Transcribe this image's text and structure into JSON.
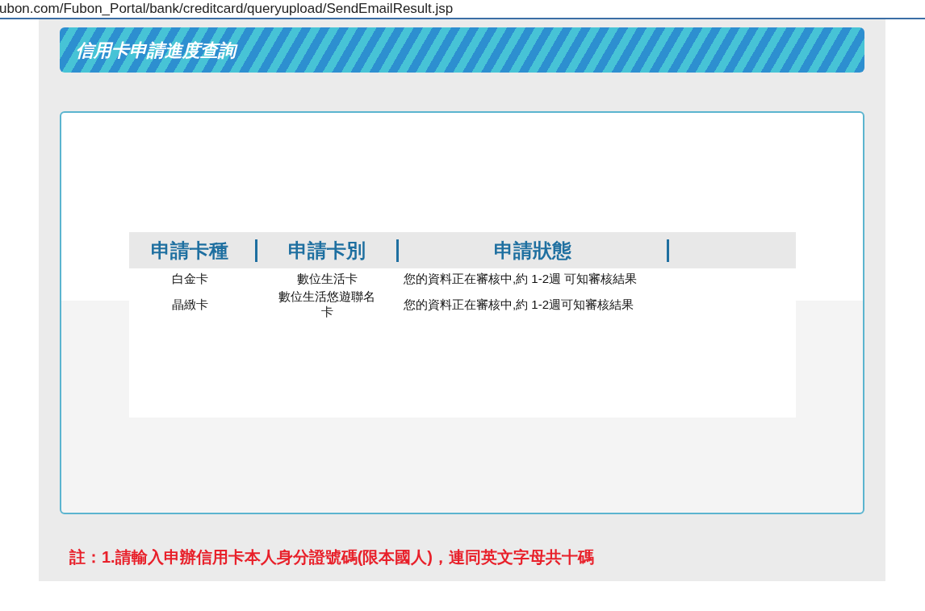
{
  "address_bar": {
    "url": "ubon.com/Fubon_Portal/bank/creditcard/queryupload/SendEmailResult.jsp"
  },
  "banner": {
    "title": "信用卡申請進度查詢"
  },
  "table": {
    "columns": [
      "申請卡種",
      "申請卡別",
      "申請狀態"
    ],
    "rows": [
      {
        "cells": [
          "白金卡",
          "數位生活卡",
          "您的資料正在審核中,約 1-2週 可知審核結果"
        ]
      },
      {
        "cells": [
          "晶緻卡",
          "數位生活悠遊聯名卡",
          "您的資料正在審核中,約 1-2週可知審核結果"
        ]
      }
    ]
  },
  "note": "註：1.請輸入申辦信用卡本人身分證號碼(限本國人)，連同英文字母共十碼"
}
